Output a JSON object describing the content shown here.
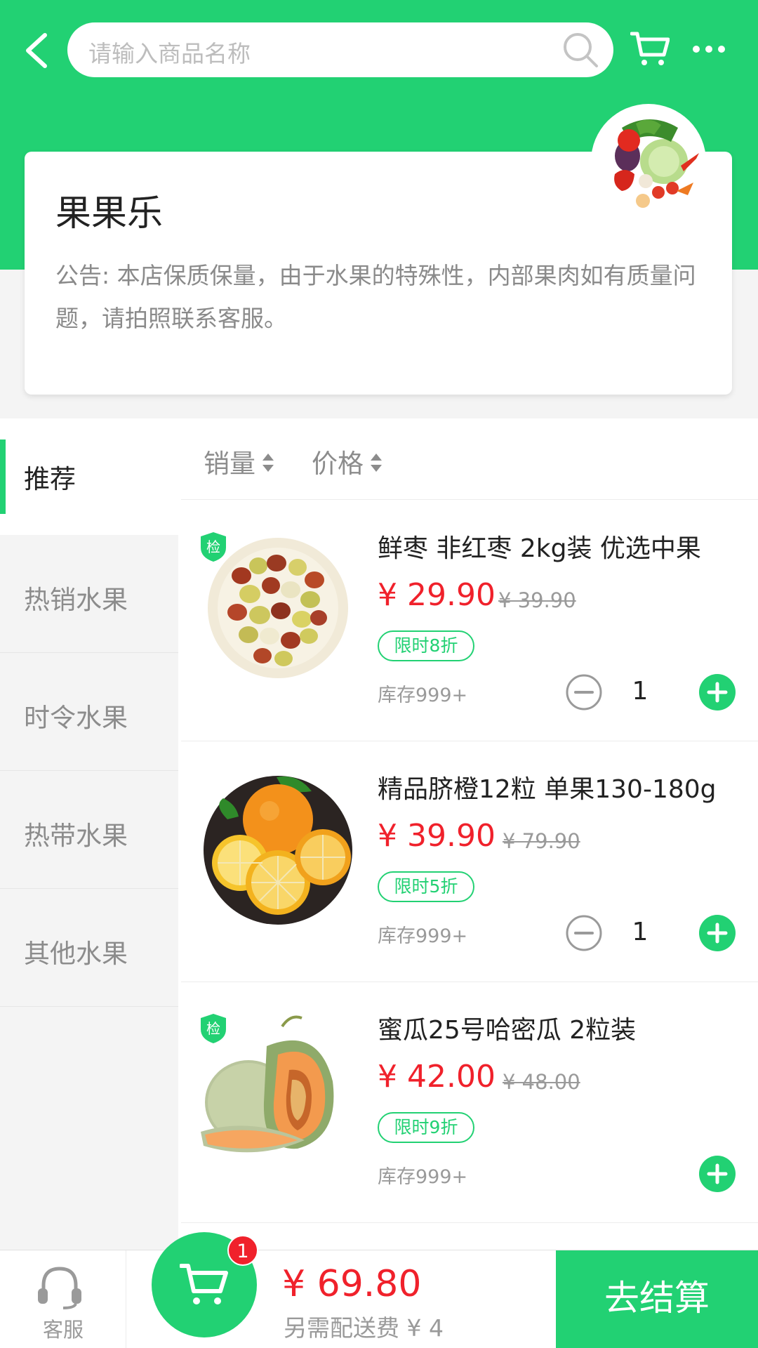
{
  "colors": {
    "accent": "#22d173",
    "price": "#f0212b",
    "muted": "#9a9a9a"
  },
  "header": {
    "search_placeholder": "请输入商品名称",
    "icons": [
      "back-icon",
      "search-icon",
      "cart-icon",
      "more-icon"
    ]
  },
  "store": {
    "name": "果果乐",
    "notice": "公告: 本店保质保量，由于水果的特殊性，内部果肉如有质量问题，请拍照联系客服。"
  },
  "categories": [
    {
      "label": "推荐",
      "active": true
    },
    {
      "label": "热销水果",
      "active": false
    },
    {
      "label": "时令水果",
      "active": false
    },
    {
      "label": "热带水果",
      "active": false
    },
    {
      "label": "其他水果",
      "active": false
    }
  ],
  "sort": {
    "sales": "销量",
    "price": "价格"
  },
  "products": [
    {
      "title": "鲜枣 非红枣 2kg装 优选中果",
      "price": "¥ 29.90",
      "original_price": "¥ 39.90",
      "tag": "限时8折",
      "stock": "库存999+",
      "qty": "1",
      "badge": "检",
      "has_badge": true,
      "has_stepper": true
    },
    {
      "title": "精品脐橙12粒 单果130-180g",
      "price": "¥ 39.90",
      "original_price": "¥ 79.90",
      "tag": "限时5折",
      "stock": "库存999+",
      "qty": "1",
      "badge": "",
      "has_badge": false,
      "has_stepper": true
    },
    {
      "title": "蜜瓜25号哈密瓜 2粒装",
      "price": "¥ 42.00",
      "original_price": "¥ 48.00",
      "tag": "限时9折",
      "stock": "库存999+",
      "qty": "",
      "badge": "检",
      "has_badge": true,
      "has_stepper": false
    }
  ],
  "bottom": {
    "service_label": "客服",
    "cart_count": "1",
    "total": "¥ 69.80",
    "shipping": "另需配送费 ¥ 4",
    "checkout": "去结算"
  }
}
